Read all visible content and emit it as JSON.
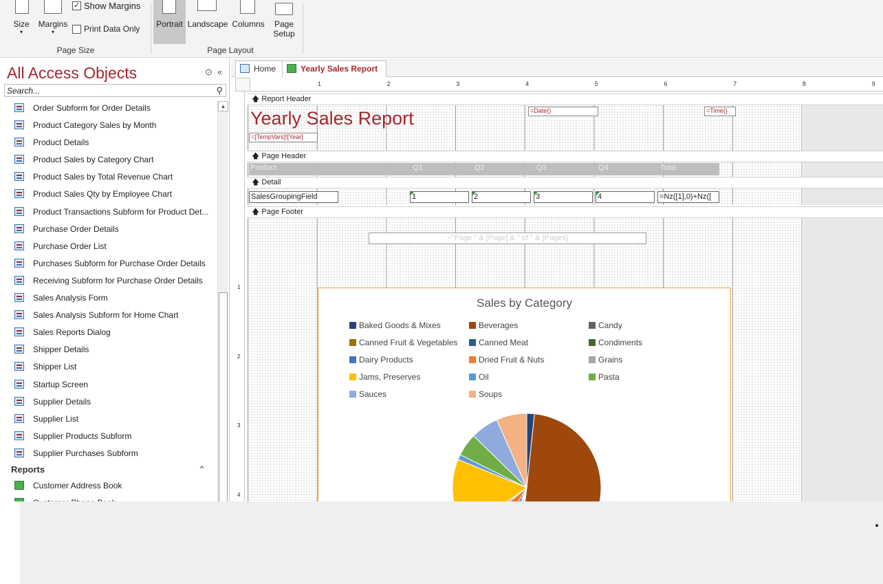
{
  "ribbon": {
    "show_margins": "Show Margins",
    "print_data_only": "Print Data Only",
    "size": "Size",
    "margins": "Margins",
    "portrait": "Portrait",
    "landscape": "Landscape",
    "columns": "Columns",
    "page_setup_1": "Page",
    "page_setup_2": "Setup",
    "group_page_size": "Page Size",
    "group_page_layout": "Page Layout"
  },
  "nav": {
    "title": "All Access Objects",
    "search_placeholder": "Search...",
    "forms": [
      "Order Subform for Order Details",
      "Product Category Sales by Month",
      "Product Details",
      "Product Sales by Category Chart",
      "Product Sales by Total Revenue Chart",
      "Product Sales Qty by Employee Chart",
      "Product Transactions Subform for Product Det...",
      "Purchase Order Details",
      "Purchase Order List",
      "Purchases Subform for Purchase Order Details",
      "Receiving Subform for Purchase Order Details",
      "Sales Analysis Form",
      "Sales Analysis Subform for Home Chart",
      "Sales Reports Dialog",
      "Shipper Details",
      "Shipper List",
      "Startup Screen",
      "Supplier Details",
      "Supplier List",
      "Supplier Products Subform",
      "Supplier Purchases Subform"
    ],
    "reports_section": "Reports",
    "reports": [
      "Customer Address Book",
      "Customer Phone Book"
    ]
  },
  "tabs": [
    {
      "label": "Home"
    },
    {
      "label": "Yearly Sales Report"
    }
  ],
  "ruler": {
    "marks": [
      "1",
      "2",
      "3",
      "4",
      "5",
      "6",
      "7",
      "8",
      "9"
    ],
    "vmarks": [
      "1",
      "2",
      "3",
      "4"
    ]
  },
  "report": {
    "sec_report_header": "Report Header",
    "title": "Yearly Sales Report",
    "date_expr": "=Date()",
    "time_expr": "=Time()",
    "tempvars_expr": "=[TempVars]![Year]",
    "sec_page_header": "Page Header",
    "header_cols": [
      "Product",
      "Q1",
      "Q2",
      "Q3",
      "Q4",
      "Total"
    ],
    "sec_detail": "Detail",
    "detail_field": "SalesGroupingField",
    "detail_vals": [
      "1",
      "2",
      "3",
      "4"
    ],
    "detail_total": "=Nz([1],0)+Nz([",
    "sec_page_footer": "Page Footer",
    "footer_expr": "=\"Page \" & [Page] & \" of \" & [Pages]"
  },
  "chart_data": {
    "type": "pie",
    "title": "Sales by Category",
    "legend_position": "top",
    "series": [
      {
        "name": "Baked Goods & Mixes",
        "value": 1.5,
        "color": "#264478"
      },
      {
        "name": "Beverages",
        "value": 45.5,
        "color": "#9e480e"
      },
      {
        "name": "Candy",
        "value": 1.0,
        "color": "#636363"
      },
      {
        "name": "Canned Fruit & Vegetables",
        "value": 1.0,
        "color": "#997300"
      },
      {
        "name": "Canned Meat",
        "value": 1.0,
        "color": "#255e91"
      },
      {
        "name": "Condiments",
        "value": 1.0,
        "color": "#43682b"
      },
      {
        "name": "Dairy Products",
        "value": 2.0,
        "color": "#4472c4"
      },
      {
        "name": "Dried Fruit & Nuts",
        "value": 5.0,
        "color": "#ed7d31"
      },
      {
        "name": "Grains",
        "value": 1.0,
        "color": "#a5a5a5"
      },
      {
        "name": "Jams, Preserves",
        "value": 14.5,
        "color": "#ffc000"
      },
      {
        "name": "Oil",
        "value": 1.0,
        "color": "#5b9bd5"
      },
      {
        "name": "Pasta",
        "value": 4.5,
        "color": "#70ad47"
      },
      {
        "name": "Sauces",
        "value": 5.5,
        "color": "#8faadc"
      },
      {
        "name": "Soups",
        "value": 6.0,
        "color": "#f4b183"
      }
    ]
  }
}
